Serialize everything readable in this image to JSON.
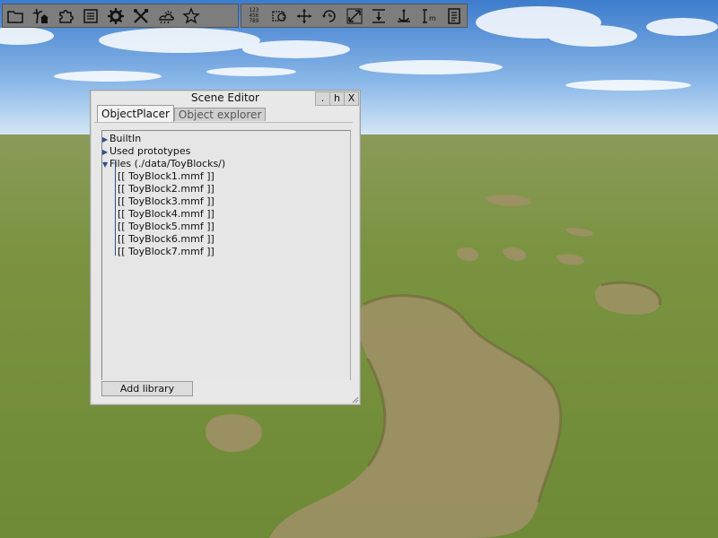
{
  "toolbar": {
    "left_buttons": [
      "folder-icon",
      "palm-tree-house-icon",
      "puzzle-icon",
      "list-icon",
      "gear-icon",
      "crossed-tools-icon",
      "weather-icon",
      "star-icon"
    ],
    "right_buttons": [
      "numgrid",
      "select-move-icon",
      "move-arrows-icon",
      "rotate-icon",
      "scale-icon",
      "align-top-icon",
      "anchor-icon",
      "measure-icon",
      "document-icon"
    ],
    "numgrid": [
      "123",
      "456",
      "789"
    ]
  },
  "window": {
    "title": "Scene Editor",
    "controls": [
      ".",
      "h",
      "X"
    ],
    "tabs": [
      "ObjectPlacer",
      "Object explorer"
    ],
    "tree": {
      "builtin": "BuiltIn",
      "used": "Used prototypes",
      "files": "Files (./data/ToyBlocks/)"
    },
    "files": [
      "[[ ToyBlock1.mmf ]]",
      "[[ ToyBlock2.mmf ]]",
      "[[ ToyBlock3.mmf ]]",
      "[[ ToyBlock4.mmf ]]",
      "[[ ToyBlock5.mmf ]]",
      "[[ ToyBlock6.mmf ]]",
      "[[ ToyBlock7.mmf ]]"
    ],
    "add_library": "Add library"
  },
  "colors": {
    "sky_top": "#4a86d0",
    "sky_horizon": "#cfe3f5",
    "grass": "#6f8a3c",
    "dirt": "#9a8a62"
  }
}
